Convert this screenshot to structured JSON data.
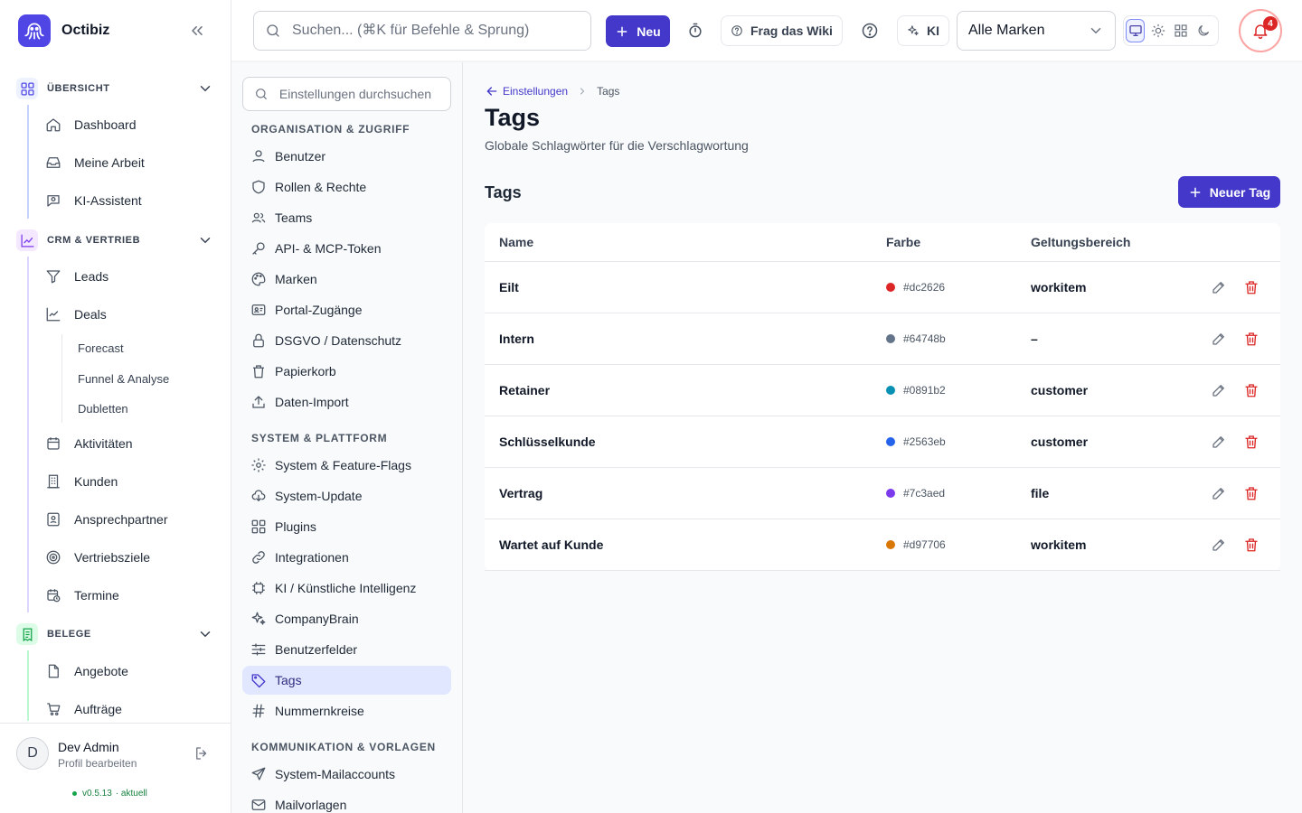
{
  "app": {
    "name": "Octibiz",
    "brand_color": "#4f46e5"
  },
  "topbar": {
    "search_placeholder": "Suchen... (⌘K für Befehle & Sprung)",
    "new_label": "Neu",
    "wiki_label": "Frag das Wiki",
    "ai_label": "KI",
    "brand_filter": "Alle Marken",
    "notification_count": "4"
  },
  "sidebar": {
    "sections": [
      {
        "label": "ÜBERSICHT",
        "items": [
          "Dashboard",
          "Meine Arbeit",
          "KI-Assistent"
        ]
      },
      {
        "label": "CRM & VERTRIEB",
        "items": [
          "Leads",
          "Deals",
          "Aktivitäten",
          "Kunden",
          "Ansprechpartner",
          "Vertriebsziele",
          "Termine"
        ],
        "sub_items": [
          "Forecast",
          "Funnel & Analyse",
          "Dubletten"
        ]
      },
      {
        "label": "BELEGE",
        "items": [
          "Angebote",
          "Aufträge"
        ]
      }
    ],
    "user": {
      "initial": "D",
      "name": "Dev Admin",
      "subtitle": "Profil bearbeiten"
    },
    "version": "v0.5.13",
    "version_status": "· aktuell"
  },
  "settings_nav": {
    "search_placeholder": "Einstellungen durchsuchen",
    "groups": [
      {
        "label": "ORGANISATION & ZUGRIFF",
        "items": [
          "Benutzer",
          "Rollen & Rechte",
          "Teams",
          "API- & MCP-Token",
          "Marken",
          "Portal-Zugänge",
          "DSGVO / Datenschutz",
          "Papierkorb",
          "Daten-Import"
        ]
      },
      {
        "label": "SYSTEM & PLATTFORM",
        "items": [
          "System & Feature-Flags",
          "System-Update",
          "Plugins",
          "Integrationen",
          "KI / Künstliche Intelligenz",
          "CompanyBrain",
          "Benutzerfelder",
          "Tags",
          "Nummernkreise"
        ]
      },
      {
        "label": "KOMMUNIKATION & VORLAGEN",
        "items": [
          "System-Mailaccounts",
          "Mailvorlagen"
        ]
      }
    ],
    "active": "Tags"
  },
  "page": {
    "breadcrumb_parent": "Einstellungen",
    "breadcrumb_current": "Tags",
    "title": "Tags",
    "subtitle": "Globale Schlagwörter für die Verschlagwortung",
    "card_title": "Tags",
    "new_tag_label": "Neuer Tag",
    "columns": [
      "Name",
      "Farbe",
      "Geltungsbereich"
    ],
    "rows": [
      {
        "name": "Eilt",
        "color": "#dc2626",
        "scope": "workitem"
      },
      {
        "name": "Intern",
        "color": "#64748b",
        "scope": "–"
      },
      {
        "name": "Retainer",
        "color": "#0891b2",
        "scope": "customer"
      },
      {
        "name": "Schlüsselkunde",
        "color": "#2563eb",
        "scope": "customer"
      },
      {
        "name": "Vertrag",
        "color": "#7c3aed",
        "scope": "file"
      },
      {
        "name": "Wartet auf Kunde",
        "color": "#d97706",
        "scope": "workitem"
      }
    ]
  }
}
